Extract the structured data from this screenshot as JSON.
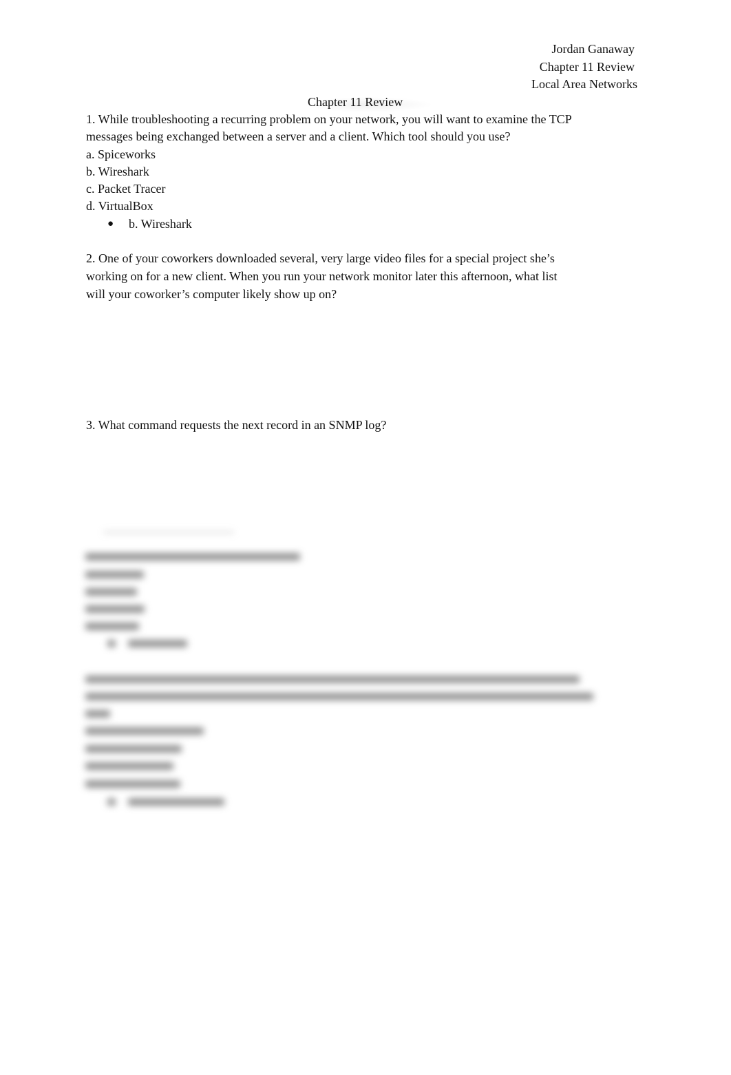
{
  "header": {
    "author": "Jordan Ganaway",
    "assignment": "Chapter 11 Review",
    "course": "Local Area Networks"
  },
  "title": "Chapter 11 Review",
  "questions": [
    {
      "lines": [
        "1. While troubleshooting a recurring problem on your network, you will want to examine the TCP",
        "messages being exchanged between a server and a client. Which tool should you use?"
      ],
      "options": [
        "a. Spiceworks",
        "b. Wireshark",
        "c. Packet Tracer",
        "d. VirtualBox"
      ],
      "answer_bullet": "●",
      "answer": "b. Wireshark"
    },
    {
      "lines": [
        "2. One of your coworkers downloaded several, very large video files for a special project she’s",
        "working on for a new client. When you run your network monitor later this afternoon, what list",
        "will your coworker’s computer likely show up on?"
      ]
    },
    {
      "lines": [
        "3. What command requests the next record in an SNMP log?"
      ]
    }
  ],
  "blurred_content_note": "Remaining questions are obscured (blurred preview)"
}
